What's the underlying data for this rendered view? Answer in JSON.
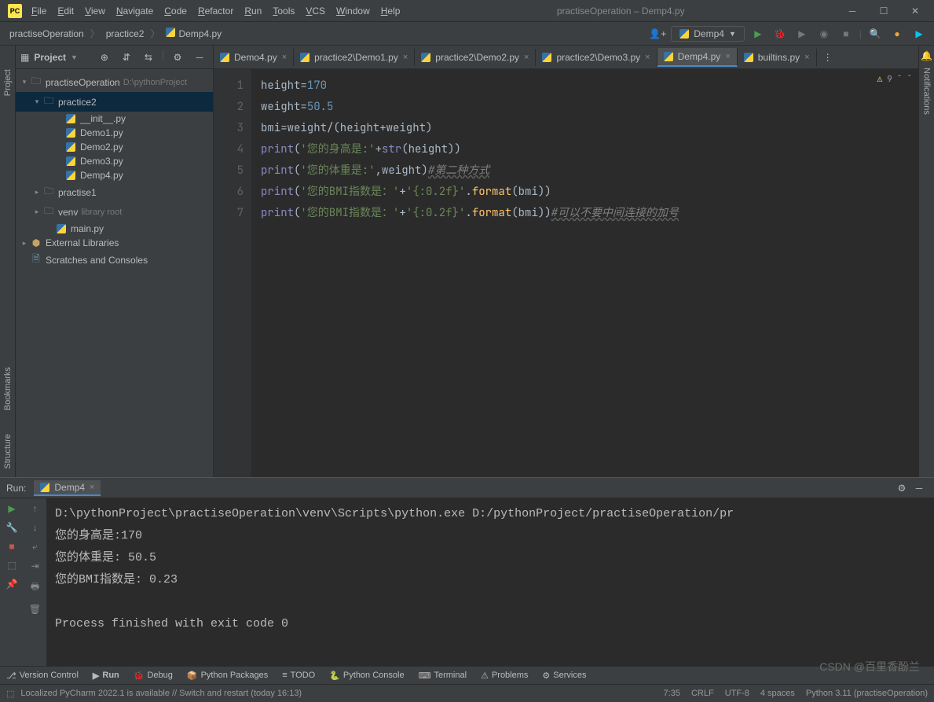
{
  "window": {
    "app_icon": "PC",
    "title": "practiseOperation – Demp4.py",
    "menu": [
      "File",
      "Edit",
      "View",
      "Navigate",
      "Code",
      "Refactor",
      "Run",
      "Tools",
      "VCS",
      "Window",
      "Help"
    ]
  },
  "breadcrumb": [
    "practiseOperation",
    "practice2",
    "Demp4.py"
  ],
  "run_config": "Demp4",
  "project": {
    "title": "Project",
    "root": {
      "name": "practiseOperation",
      "path": "D:\\pythonProject"
    },
    "practice2": "practice2",
    "files_p2": [
      "__init__.py",
      "Demo1.py",
      "Demo2.py",
      "Demo3.py",
      "Demp4.py"
    ],
    "practise1": "practise1",
    "venv": {
      "name": "venv",
      "hint": "library root"
    },
    "main": "main.py",
    "ext_lib": "External Libraries",
    "scratches": "Scratches and Consoles"
  },
  "tabs": [
    "Demo4.py",
    "practice2\\Demo1.py",
    "practice2\\Demo2.py",
    "practice2\\Demo3.py",
    "Demp4.py",
    "builtins.py"
  ],
  "active_tab": 4,
  "code": {
    "warning_count": "9",
    "lines": [
      {
        "n": "1",
        "t": [
          [
            "",
            "height"
          ],
          [
            "",
            "="
          ],
          [
            "num",
            "170"
          ]
        ]
      },
      {
        "n": "2",
        "t": [
          [
            "",
            "weight"
          ],
          [
            "",
            "="
          ],
          [
            "num",
            "50.5"
          ]
        ]
      },
      {
        "n": "3",
        "t": [
          [
            "",
            "bmi"
          ],
          [
            "",
            "="
          ],
          [
            "",
            "weight"
          ],
          [
            "",
            "/("
          ],
          [
            "",
            "height"
          ],
          [
            "",
            "+"
          ],
          [
            "",
            "weight"
          ],
          [
            "",
            ")"
          ]
        ]
      },
      {
        "n": "4",
        "t": [
          [
            "bi",
            "print"
          ],
          [
            "",
            "("
          ],
          [
            "str",
            "'您的身高是:'"
          ],
          [
            "",
            "+"
          ],
          [
            "bi",
            "str"
          ],
          [
            "",
            "("
          ],
          [
            "",
            "height"
          ],
          [
            "",
            ")) "
          ]
        ]
      },
      {
        "n": "5",
        "t": [
          [
            "bi",
            "print"
          ],
          [
            "",
            "("
          ],
          [
            "str",
            "'您的体重是:'"
          ],
          [
            "",
            ","
          ],
          [
            "",
            "weight"
          ],
          [
            "",
            ")"
          ],
          [
            "cmtul",
            "#第二种方式"
          ]
        ]
      },
      {
        "n": "6",
        "t": [
          [
            "bi",
            "print"
          ],
          [
            "",
            "("
          ],
          [
            "str",
            "'您的BMI指数是：'"
          ],
          [
            "",
            "+"
          ],
          [
            "str",
            "'{:0.2f}'"
          ],
          [
            "",
            "."
          ],
          [
            "fn",
            "format"
          ],
          [
            "",
            "("
          ],
          [
            "",
            "bmi"
          ],
          [
            "",
            "))"
          ]
        ]
      },
      {
        "n": "7",
        "t": [
          [
            "bi",
            "print"
          ],
          [
            "",
            "("
          ],
          [
            "str",
            "'您的BMI指数是：'"
          ],
          [
            "",
            "+"
          ],
          [
            "str",
            "'{:0.2f}'"
          ],
          [
            "",
            "."
          ],
          [
            "fn",
            "format"
          ],
          [
            "",
            "("
          ],
          [
            "",
            "bmi"
          ],
          [
            "",
            "))"
          ],
          [
            "cmtul",
            "#可以不要中间连接的加号"
          ]
        ]
      }
    ]
  },
  "run": {
    "label": "Run:",
    "tab": "Demp4",
    "output": [
      "D:\\pythonProject\\practiseOperation\\venv\\Scripts\\python.exe D:/pythonProject/practiseOperation/pr",
      "您的身高是:170",
      "您的体重是: 50.5",
      "您的BMI指数是: 0.23",
      "",
      "Process finished with exit code 0"
    ]
  },
  "bottom_tabs": [
    "Version Control",
    "Run",
    "Debug",
    "Python Packages",
    "TODO",
    "Python Console",
    "Terminal",
    "Problems",
    "Services"
  ],
  "status": {
    "msg": "Localized PyCharm 2022.1 is available // Switch and restart (today 16:13)",
    "pos": "7:35",
    "eol": "CRLF",
    "enc": "UTF-8",
    "indent": "4 spaces",
    "interp": "Python 3.11 (practiseOperation)"
  },
  "sidebars": {
    "left": [
      "Project"
    ],
    "left_bottom": [
      "Bookmarks",
      "Structure"
    ],
    "right": [
      "Notifications"
    ]
  },
  "watermark": "CSDN @百里香酚兰"
}
